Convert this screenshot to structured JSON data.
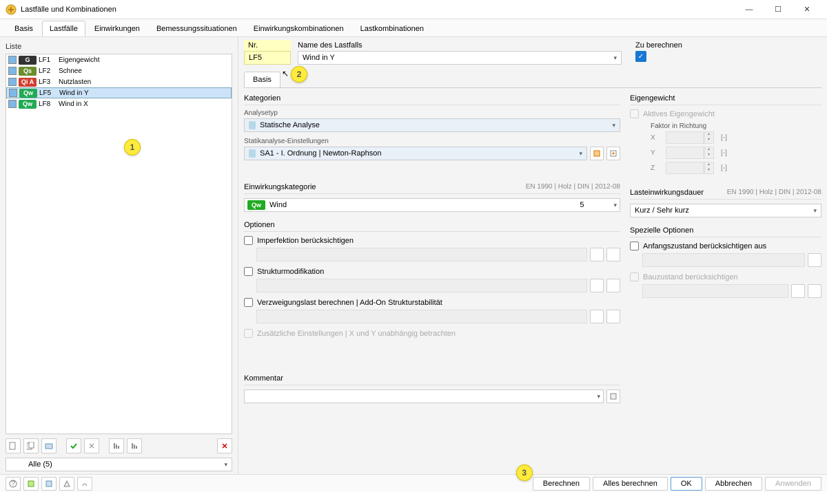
{
  "window": {
    "title": "Lastfälle und Kombinationen"
  },
  "main_tabs": [
    "Basis",
    "Lastfälle",
    "Einwirkungen",
    "Bemessungssituationen",
    "Einwirkungskombinationen",
    "Lastkombinationen"
  ],
  "main_tabs_active": 1,
  "left": {
    "label": "Liste",
    "items": [
      {
        "id": "LF1",
        "name": "Eigengewicht",
        "badge": "G",
        "color": "#333333"
      },
      {
        "id": "LF2",
        "name": "Schnee",
        "badge": "Qs",
        "color": "#6a8e2e"
      },
      {
        "id": "LF3",
        "name": "Nutzlasten",
        "badge": "Qi A",
        "color": "#d04030"
      },
      {
        "id": "LF5",
        "name": "Wind in Y",
        "badge": "Qw",
        "color": "#22aa55",
        "selected": true
      },
      {
        "id": "LF8",
        "name": "Wind in X",
        "badge": "Qw",
        "color": "#22aa55"
      }
    ],
    "filter": "Alle (5)"
  },
  "header": {
    "nr_label": "Nr.",
    "nr_value": "LF5",
    "name_label": "Name des Lastfalls",
    "name_value": "Wind in Y",
    "calc_label": "Zu berechnen"
  },
  "sub_tab": "Basis",
  "kategorien": {
    "title": "Kategorien",
    "analysetyp_label": "Analysetyp",
    "analysetyp_value": "Statische Analyse",
    "statik_label": "Statikanalyse-Einstellungen",
    "statik_value": "SA1 - I. Ordnung | Newton-Raphson"
  },
  "eigengewicht": {
    "title": "Eigengewicht",
    "active_label": "Aktives Eigengewicht",
    "faktor_label": "Faktor in Richtung",
    "axes": [
      "X",
      "Y",
      "Z"
    ],
    "unit": "[-]"
  },
  "einwirkung": {
    "title": "Einwirkungskategorie",
    "standard": "EN 1990 | Holz | DIN | 2012-08",
    "badge": "Qw",
    "value": "Wind",
    "num": "5"
  },
  "lasteinwirkung": {
    "title": "Lasteinwirkungsdauer",
    "standard": "EN 1990 | Holz | DIN | 2012-08",
    "value": "Kurz / Sehr kurz"
  },
  "optionen": {
    "title": "Optionen",
    "imperfektion": "Imperfektion berücksichtigen",
    "struktur": "Strukturmodifikation",
    "verzweigung": "Verzweigungslast berechnen | Add-On Strukturstabilität",
    "zusatz": "Zusätzliche Einstellungen | X und Y unabhängig betrachten"
  },
  "spezielle": {
    "title": "Spezielle Optionen",
    "anfang": "Anfangszustand berücksichtigen aus",
    "bau": "Bauzustand berücksichtigen"
  },
  "kommentar": {
    "title": "Kommentar"
  },
  "footer": {
    "berechnen": "Berechnen",
    "alles": "Alles berechnen",
    "ok": "OK",
    "abbrechen": "Abbrechen",
    "anwenden": "Anwenden"
  },
  "markers": {
    "m1": "1",
    "m2": "2",
    "m3": "3"
  }
}
